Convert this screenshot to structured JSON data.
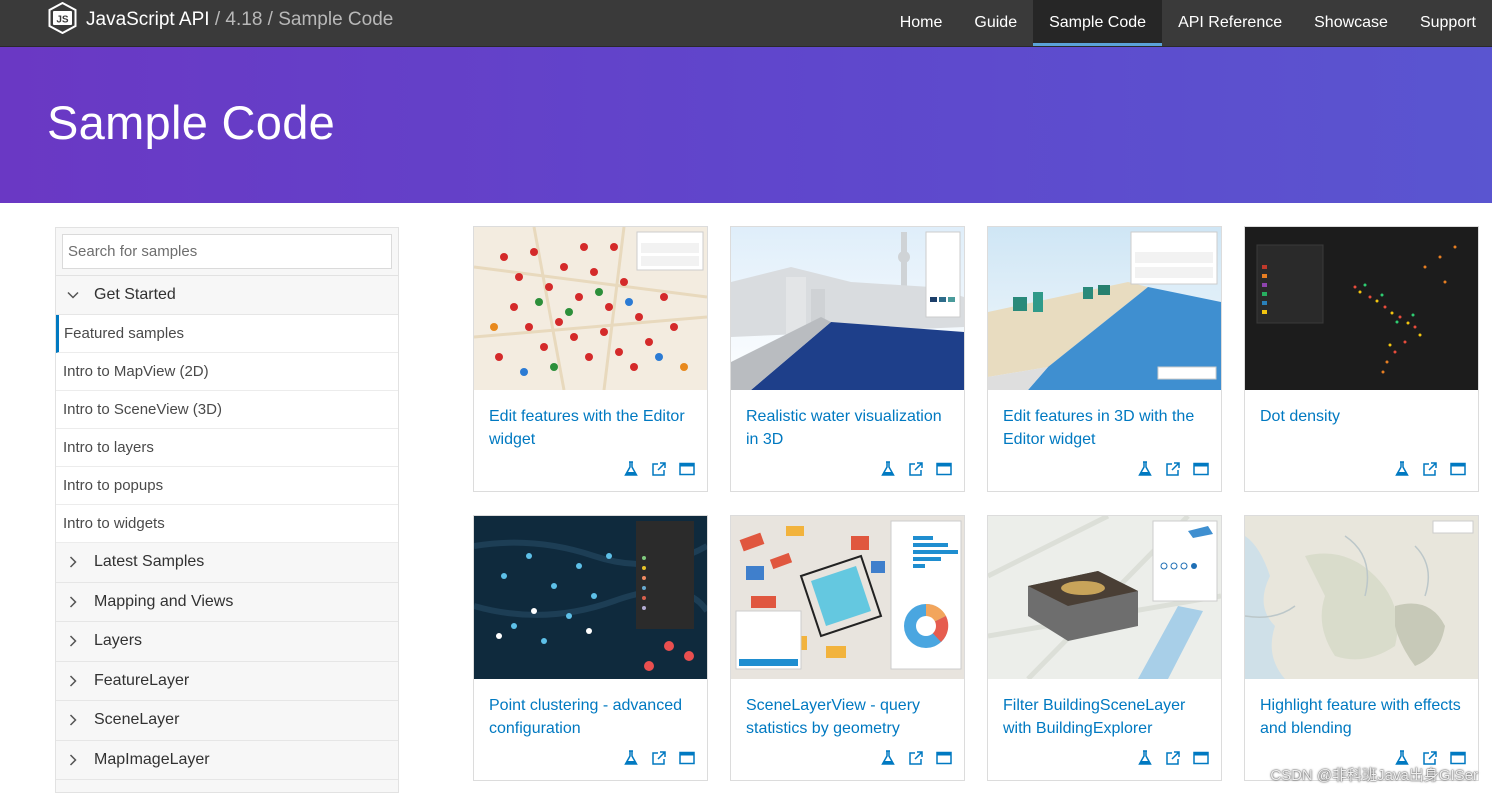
{
  "header": {
    "product": "JavaScript API",
    "separator": "/",
    "version": "4.18",
    "section": "Sample Code",
    "logo_icon": "js-shield-icon",
    "logo_text": "JS",
    "nav": [
      "Home",
      "Guide",
      "Sample Code",
      "API Reference",
      "Showcase",
      "Support"
    ],
    "active_nav": "Sample Code"
  },
  "hero": {
    "title": "Sample Code"
  },
  "sidebar": {
    "search_placeholder": "Search for samples",
    "get_started": {
      "label": "Get Started",
      "items": [
        "Featured samples",
        "Intro to MapView (2D)",
        "Intro to SceneView (3D)",
        "Intro to layers",
        "Intro to popups",
        "Intro to widgets"
      ],
      "active": "Featured samples"
    },
    "sections": [
      "Latest Samples",
      "Mapping and Views",
      "Layers",
      "FeatureLayer",
      "SceneLayer",
      "MapImageLayer"
    ]
  },
  "cards": [
    {
      "title": "Edit features with the Editor widget"
    },
    {
      "title": "Realistic water visualization in 3D"
    },
    {
      "title": "Edit features in 3D with the Editor widget"
    },
    {
      "title": "Dot density"
    },
    {
      "title": "Point clustering - advanced configuration"
    },
    {
      "title": "SceneLayerView - query statistics by geometry"
    },
    {
      "title": "Filter BuildingSceneLayer with BuildingExplorer"
    },
    {
      "title": "Highlight feature with effects and blending"
    }
  ],
  "card_icons": [
    "flask-icon",
    "external-link-icon",
    "browser-window-icon"
  ],
  "watermark": "CSDN @非科班Java出身GISer",
  "colors": {
    "nav_bg": "#3a3a3a",
    "hero_start": "#6a38c4",
    "hero_end": "#5a55d0",
    "link": "#0079c1",
    "active_indicator": "#5ba3d9"
  }
}
